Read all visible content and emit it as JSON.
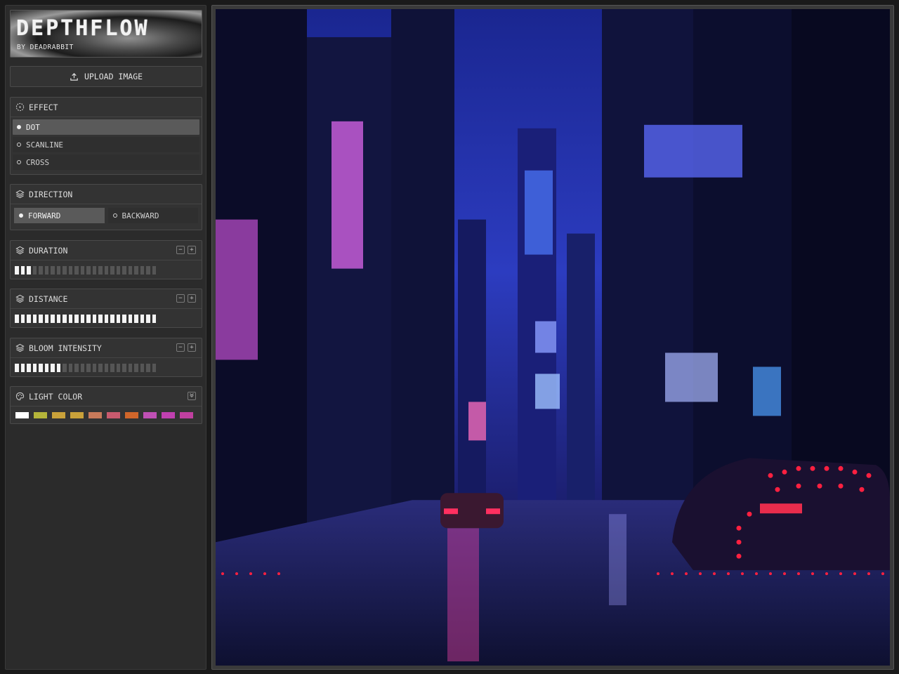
{
  "app": {
    "title": "DEPTHFLOW",
    "subtitle": "BY DEADRABBIT"
  },
  "upload": {
    "label": "UPLOAD IMAGE"
  },
  "effect": {
    "title": "EFFECT",
    "options": [
      "DOT",
      "SCANLINE",
      "CROSS"
    ],
    "selected": "DOT"
  },
  "direction": {
    "title": "DIRECTION",
    "options": [
      "FORWARD",
      "BACKWARD"
    ],
    "selected": "FORWARD"
  },
  "duration": {
    "title": "DURATION",
    "level": 3,
    "max": 24
  },
  "distance": {
    "title": "DISTANCE",
    "level": 24,
    "max": 24
  },
  "bloom": {
    "title": "BLOOM INTENSITY",
    "level": 8,
    "max": 24
  },
  "light_color": {
    "title": "LIGHT COLOR",
    "swatches": [
      "#ffffff",
      "#b5b53a",
      "#c9a13a",
      "#c9a13a",
      "#c87a5a",
      "#c85a6e",
      "#d0662a",
      "#c050b5",
      "#c040b0",
      "#c040a0"
    ]
  },
  "icons": {
    "upload": "upload-icon",
    "effect": "dashed-circle-icon",
    "layers": "layers-icon",
    "palette": "palette-icon",
    "dropdown": "chevron-down-icon"
  }
}
